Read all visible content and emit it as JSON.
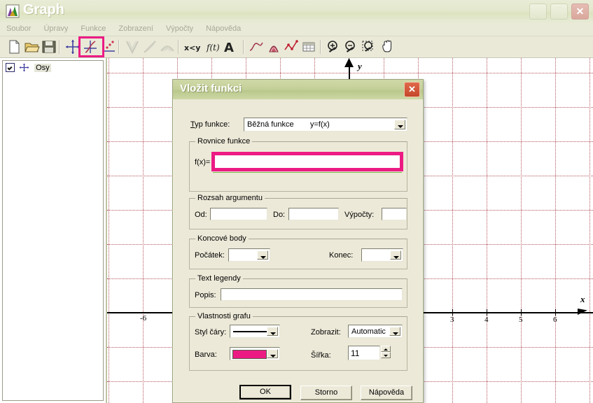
{
  "window": {
    "title": "Graph",
    "icon": "graph-app-icon",
    "buttons": {
      "minimize": "–",
      "maximize": "❐",
      "close": "✕"
    }
  },
  "menubar": {
    "items": [
      {
        "label": "Soubor",
        "name": "menu-soubor"
      },
      {
        "label": "Úpravy",
        "name": "menu-upravy"
      },
      {
        "label": "Funkce",
        "name": "menu-funkce"
      },
      {
        "label": "Zobrazení",
        "name": "menu-zobrazeni"
      },
      {
        "label": "Výpočty",
        "name": "menu-vypocty"
      },
      {
        "label": "Nápověda",
        "name": "menu-napoveda"
      }
    ]
  },
  "toolbar": {
    "highlight_color": "#ec1b84",
    "buttons": [
      {
        "name": "new-file-icon",
        "x": 8
      },
      {
        "name": "open-file-icon",
        "x": 33
      },
      {
        "name": "save-file-icon",
        "x": 58
      },
      {
        "name": "insert-axes-icon",
        "x": 92
      },
      {
        "name": "insert-function-icon",
        "x": 117
      },
      {
        "name": "insert-point-series-icon",
        "x": 142
      },
      {
        "name": "insert-relation-icon",
        "x": 177
      },
      {
        "name": "insert-tangent-icon",
        "x": 202
      },
      {
        "name": "insert-shading-icon",
        "x": 227
      },
      {
        "name": "insert-inequality-icon",
        "x": 262
      },
      {
        "name": "insert-parametric-icon",
        "x": 292
      },
      {
        "name": "insert-label-icon",
        "x": 318
      },
      {
        "name": "trendline-icon",
        "x": 355
      },
      {
        "name": "fill-area-icon",
        "x": 380
      },
      {
        "name": "point-series-red-icon",
        "x": 405
      },
      {
        "name": "table-icon",
        "x": 430
      },
      {
        "name": "zoom-in-icon",
        "x": 465
      },
      {
        "name": "zoom-out-icon",
        "x": 490
      },
      {
        "name": "zoom-window-icon",
        "x": 515
      },
      {
        "name": "pan-hand-icon",
        "x": 542
      }
    ],
    "separators": [
      84,
      169,
      254,
      347,
      457
    ]
  },
  "tree": {
    "items": [
      {
        "label": "Osy",
        "checked": true,
        "icon": "axes-icon",
        "name": "tree-item-osy"
      }
    ]
  },
  "graph": {
    "x_axis_label": "x",
    "y_axis_label": "y",
    "x_ticks": [
      {
        "label": "-6",
        "x": 51
      },
      {
        "label": "3",
        "x": 493
      },
      {
        "label": "4",
        "x": 542
      },
      {
        "label": "5",
        "x": 591
      },
      {
        "label": "6",
        "x": 640
      }
    ],
    "grid_color": "#b4555e",
    "axis_color": "#000000"
  },
  "dialog": {
    "title": "Vložit funkci",
    "close_label": "✕",
    "type_label": "T",
    "type_label_rest": "yp funkce:",
    "type_value": "Běžná funkce",
    "type_value_formula": "y=f(x)",
    "equation_group": "Rovnice funkce",
    "equation_prefix": "f(x)=",
    "equation_value": "",
    "range_group": "Rozsah argumentu",
    "range_from_label": "Od:",
    "range_from_value": "",
    "range_to_label": "Do:",
    "range_to_value": "",
    "range_steps_label": "Výpočty:",
    "range_steps_value": "",
    "endpoints_group": "Koncové body",
    "endpoint_start_label": "Počátek:",
    "endpoint_start_value": "",
    "endpoint_end_label": "Konec:",
    "endpoint_end_value": "",
    "legend_group": "Text legendy",
    "legend_label": "Popis:",
    "legend_value": "",
    "props_group": "Vlastnosti grafu",
    "linestyle_label": "Styl čáry:",
    "color_label": "Barva:",
    "color_value": "#ec1b84",
    "show_label": "Zobrazit:",
    "show_value": "Automatic",
    "width_label": "Šířka:",
    "width_value": "11",
    "buttons": {
      "ok": "OK",
      "cancel": "Storno",
      "help": "Nápověda"
    }
  }
}
